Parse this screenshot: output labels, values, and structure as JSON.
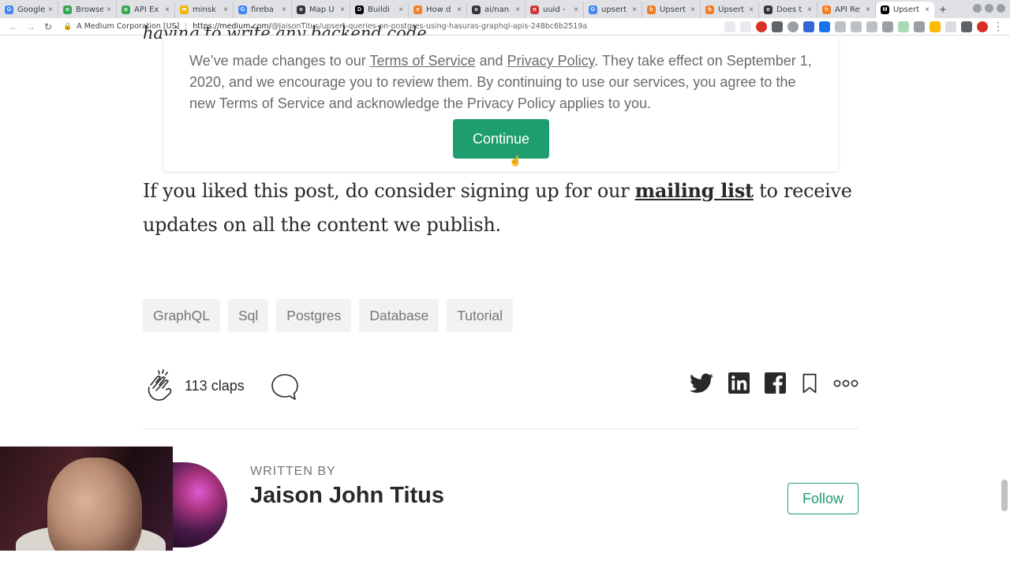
{
  "browser": {
    "tabs": [
      {
        "title": "Google",
        "favicon_color": "#4285f4",
        "favicon_glyph": "G"
      },
      {
        "title": "Browse",
        "favicon_color": "#34a853",
        "favicon_glyph": "o"
      },
      {
        "title": "API Ex",
        "favicon_color": "#34a853",
        "favicon_glyph": "o"
      },
      {
        "title": "minsk",
        "favicon_color": "#f4b400",
        "favicon_glyph": "m"
      },
      {
        "title": "fireba",
        "favicon_color": "#4285f4",
        "favicon_glyph": "G"
      },
      {
        "title": "Map U",
        "favicon_color": "#333333",
        "favicon_glyph": "o"
      },
      {
        "title": "Buildi",
        "favicon_color": "#000000",
        "favicon_glyph": "D"
      },
      {
        "title": "How d",
        "favicon_color": "#f48024",
        "favicon_glyph": "s"
      },
      {
        "title": "ai/nan",
        "favicon_color": "#333333",
        "favicon_glyph": "o"
      },
      {
        "title": "uuid -",
        "favicon_color": "#cb3837",
        "favicon_glyph": "n"
      },
      {
        "title": "upsert",
        "favicon_color": "#4285f4",
        "favicon_glyph": "G"
      },
      {
        "title": "Upsert",
        "favicon_color": "#f47c20",
        "favicon_glyph": "h"
      },
      {
        "title": "Upsert",
        "favicon_color": "#f47c20",
        "favicon_glyph": "h"
      },
      {
        "title": "Does t",
        "favicon_color": "#333333",
        "favicon_glyph": "o"
      },
      {
        "title": "API Re",
        "favicon_color": "#f47c20",
        "favicon_glyph": "h"
      },
      {
        "title": "Upsert",
        "favicon_color": "#000000",
        "favicon_glyph": "M",
        "active": true
      }
    ],
    "close_glyph": "×",
    "new_tab_glyph": "+",
    "site_identity": "A Medium Corporation [US]",
    "url_host": "https://medium.com/",
    "url_path": "@JaisonTitus/upsert-queries-on-postgres-using-hasuras-graphql-apis-248bc6b2519a",
    "back_icon": "←",
    "forward_icon": "→",
    "reload_icon": "↻",
    "lock_icon": "🔒",
    "menu_icon": "⋮"
  },
  "article": {
    "cut_off_text": "having to write any backend code."
  },
  "notice": {
    "text_before_tos": "We’ve made changes to our ",
    "tos_link": "Terms of Service",
    "text_and": " and ",
    "privacy_link": "Privacy Policy",
    "text_after": ". They take effect on September 1, 2020, and we encourage you to review them. By continuing to use our services, you agree to the new Terms of Service and acknowledge the Privacy Policy applies to you.",
    "continue_label": "Continue"
  },
  "closing": {
    "before_link": "If you liked this post, do consider signing up for our ",
    "link": "mailing list",
    "after_link": " to receive updates on all the content we publish."
  },
  "tags": [
    "GraphQL",
    "Sql",
    "Postgres",
    "Database",
    "Tutorial"
  ],
  "actions": {
    "claps": "113 claps"
  },
  "author": {
    "written_by": "WRITTEN BY",
    "name": "Jaison John Titus",
    "follow_label": "Follow"
  },
  "colors": {
    "accent_green": "#1e9e6e",
    "text": "#292929",
    "muted": "#757575"
  }
}
